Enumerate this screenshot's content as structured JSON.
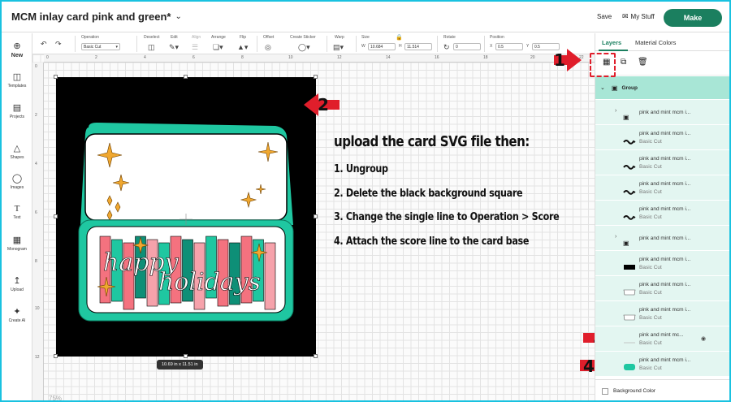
{
  "header": {
    "title": "MCM inlay card pink and green*",
    "save_label": "Save",
    "mystuff_label": "My Stuff",
    "make_label": "Make"
  },
  "leftbar": {
    "items": [
      {
        "label": "New",
        "icon": "plus-icon"
      },
      {
        "label": "Templates",
        "icon": "shirt-icon"
      },
      {
        "label": "Projects",
        "icon": "projects-icon"
      },
      {
        "label": "Shapes",
        "icon": "shapes-icon"
      },
      {
        "label": "Images",
        "icon": "lightbulb-icon"
      },
      {
        "label": "Text",
        "icon": "text-icon"
      },
      {
        "label": "Monogram",
        "icon": "monogram-icon"
      },
      {
        "label": "Upload",
        "icon": "upload-icon"
      },
      {
        "label": "Create AI",
        "icon": "sparkle-icon"
      }
    ]
  },
  "toolbar": {
    "operation_label": "Operation",
    "operation_value": "Basic Cut",
    "deselect_label": "Deselect",
    "edit_label": "Edit",
    "align_label": "Align",
    "arrange_label": "Arrange",
    "flip_label": "Flip",
    "offset_label": "Offset",
    "sticker_label": "Create Sticker",
    "warp_label": "Warp",
    "size_label": "Size",
    "w_label": "W",
    "w_value": "10.684",
    "h_label": "H",
    "h_value": "11.514",
    "rotate_label": "Rotate",
    "rotate_value": "0",
    "position_label": "Position",
    "x_label": "X",
    "x_value": "0.5",
    "y_label": "Y",
    "y_value": "0.5"
  },
  "canvas": {
    "ruler_top": [
      "0",
      "2",
      "4",
      "6",
      "8",
      "10",
      "12",
      "14",
      "16",
      "18",
      "20",
      "22"
    ],
    "ruler_left": [
      "0",
      "2",
      "4",
      "6",
      "8",
      "10",
      "12"
    ],
    "size_badge": "10.69  in x 11.51  in",
    "zoom": "75%"
  },
  "card": {
    "text_line1": "happy",
    "text_line2": "holidays"
  },
  "instructions": {
    "title": "upload the card SVG file then:",
    "steps": [
      "1. Ungroup",
      "2. Delete the black background square",
      "3. Change the single line to Operation > Score",
      "4. Attach the score line  to the card base"
    ]
  },
  "callouts": [
    "1",
    "2",
    "3",
    "4"
  ],
  "panel": {
    "tab_layers": "Layers",
    "tab_colors": "Material Colors",
    "group_label": "Group",
    "layers": [
      {
        "name": "pink and mint mcm i...",
        "op": "",
        "thumb": "group",
        "expand": true
      },
      {
        "name": "pink and mint mcm i...",
        "op": "Basic Cut",
        "thumb": "squiggle",
        "expand": false
      },
      {
        "name": "pink and mint mcm i...",
        "op": "Basic Cut",
        "thumb": "squiggle",
        "expand": false
      },
      {
        "name": "pink and mint mcm i...",
        "op": "Basic Cut",
        "thumb": "squiggle",
        "expand": false
      },
      {
        "name": "pink and mint mcm i...",
        "op": "Basic Cut",
        "thumb": "squiggle",
        "expand": false
      },
      {
        "name": "pink and mint mcm i...",
        "op": "",
        "thumb": "group",
        "expand": true
      },
      {
        "name": "pink and mint mcm i...",
        "op": "Basic Cut",
        "thumb": "black",
        "expand": false
      },
      {
        "name": "pink and mint mcm i...",
        "op": "Basic Cut",
        "thumb": "white",
        "expand": false
      },
      {
        "name": "pink and mint mcm i...",
        "op": "Basic Cut",
        "thumb": "white",
        "expand": false
      },
      {
        "name": "pink and mint mc...",
        "op": "Basic Cut",
        "thumb": "line",
        "expand": false
      },
      {
        "name": "pink and mint mcm i...",
        "op": "Basic Cut",
        "thumb": "mint",
        "expand": false
      }
    ],
    "background_label": "Background Color"
  },
  "colors": {
    "accent": "#1b7f5f",
    "mint": "#1fc7a1",
    "pink": "#f4727f",
    "callout_red": "#e01e2b",
    "selected_row": "#a8e6d6"
  }
}
